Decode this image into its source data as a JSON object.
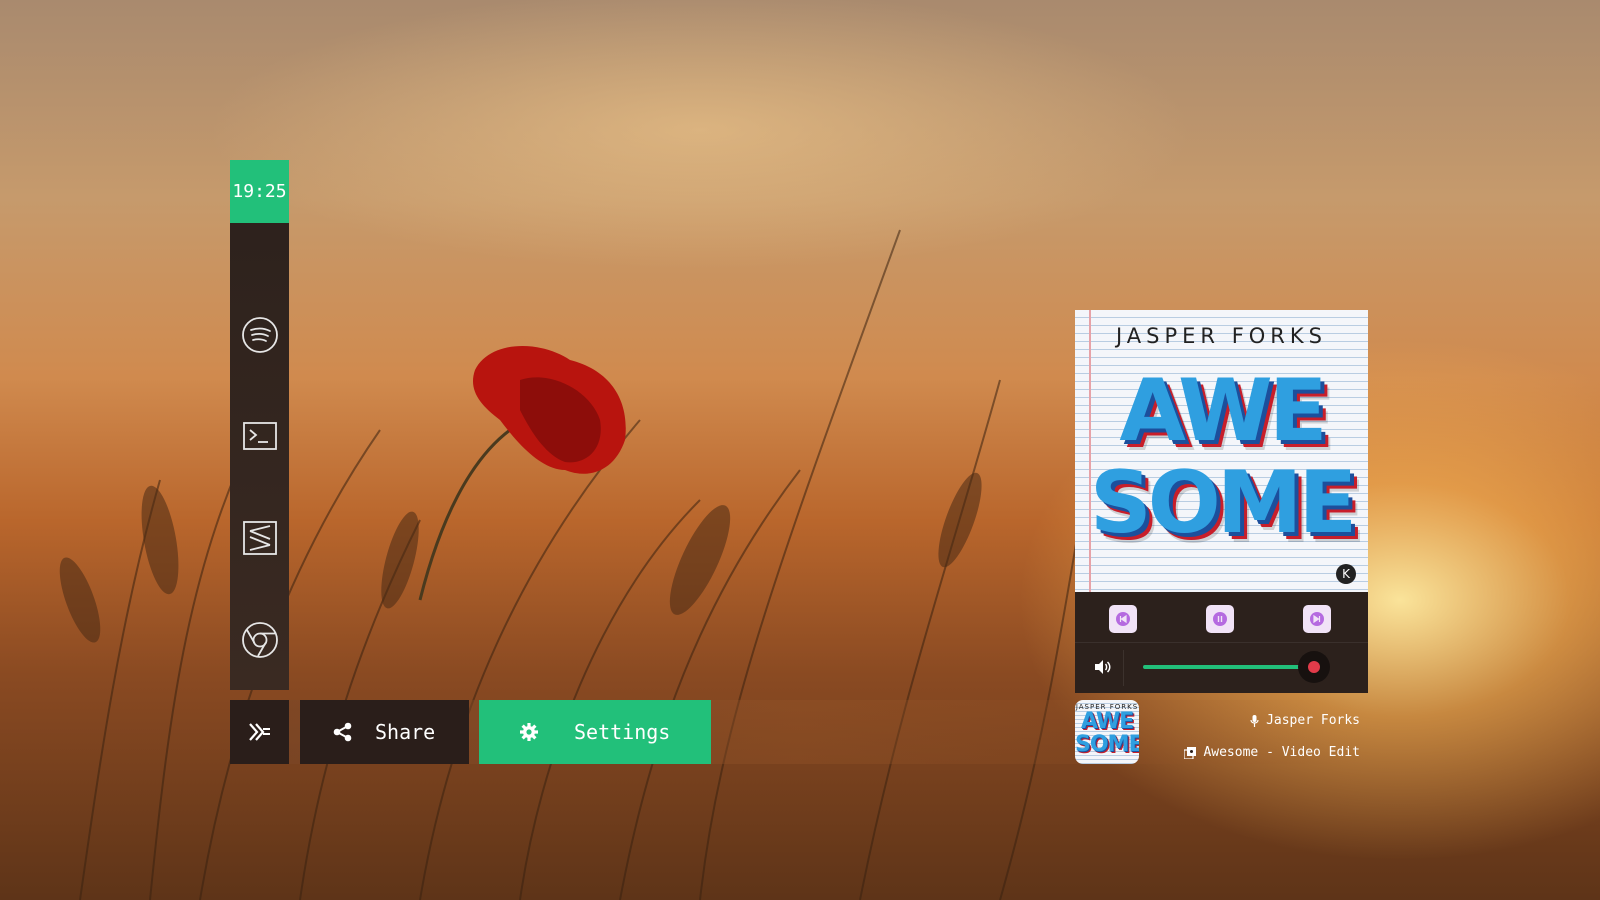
{
  "dock": {
    "clock": "19:25",
    "apps": [
      {
        "name": "spotify-icon"
      },
      {
        "name": "terminal-icon"
      },
      {
        "name": "sublime-text-icon"
      },
      {
        "name": "chrome-icon"
      }
    ]
  },
  "bottom_bar": {
    "share_label": "Share",
    "settings_label": "Settings"
  },
  "player": {
    "cover": {
      "artist": "JASPER FORKS",
      "title_line1": "AWE",
      "title_line2": "SOME",
      "thumb_title1": "AWE",
      "thumb_title2": "SOME"
    },
    "controls": [
      "previous-icon",
      "pause-icon",
      "next-icon"
    ],
    "volume": 0.95
  },
  "now_playing": {
    "artist": "Jasper Forks",
    "track": "Awesome - Video Edit"
  },
  "colors": {
    "accent": "#22c07a",
    "panel": "#2a1e1a",
    "control_bg": "#f1e3f7",
    "control_icon": "#b56ae0",
    "knob": "#e23b4a"
  }
}
